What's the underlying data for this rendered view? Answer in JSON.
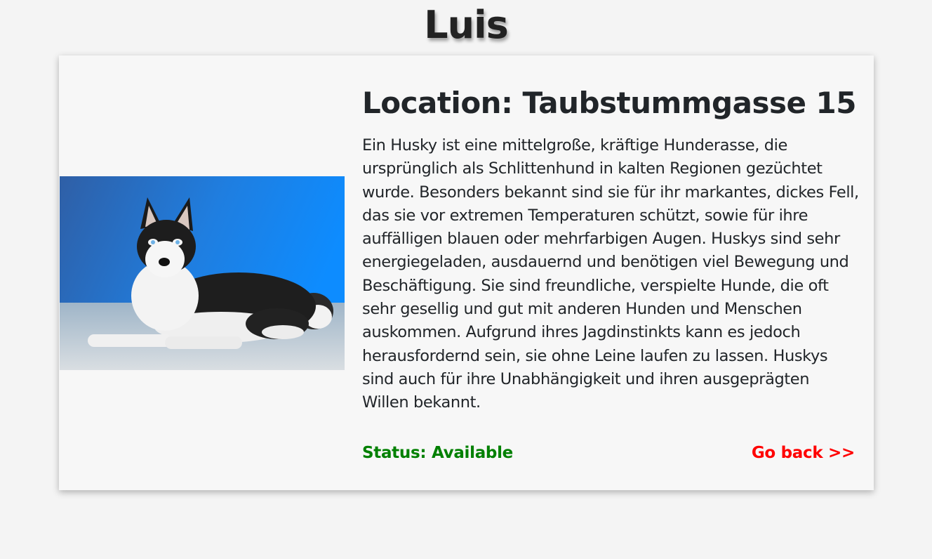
{
  "page": {
    "title": "Luis"
  },
  "card": {
    "location_heading": "Location: Taubstummgasse 15",
    "description": "Ein Husky ist eine mittelgroße, kräftige Hunderasse, die ursprünglich als Schlittenhund in kalten Regionen gezüchtet wurde. Besonders bekannt sind sie für ihr markantes, dickes Fell, das sie vor extremen Temperaturen schützt, sowie für ihre auffälligen blauen oder mehrfarbigen Augen. Huskys sind sehr energiegeladen, ausdauernd und benötigen viel Bewegung und Beschäftigung. Sie sind freundliche, verspielte Hunde, die oft sehr gesellig und gut mit anderen Hunden und Menschen auskommen. Aufgrund ihres Jagdinstinkts kann es jedoch herausfordernd sein, sie ohne Leine laufen zu lassen. Huskys sind auch für ihre Unabhängigkeit und ihren ausgeprägten Willen bekannt.",
    "status_text": "Status: Available",
    "go_back_label": "Go back >>",
    "image_subject": "husky-dog-photo"
  },
  "colors": {
    "status": "#008000",
    "link": "#ff0000",
    "card_background": "#f7f7f7",
    "page_background": "#f4f4f4"
  }
}
